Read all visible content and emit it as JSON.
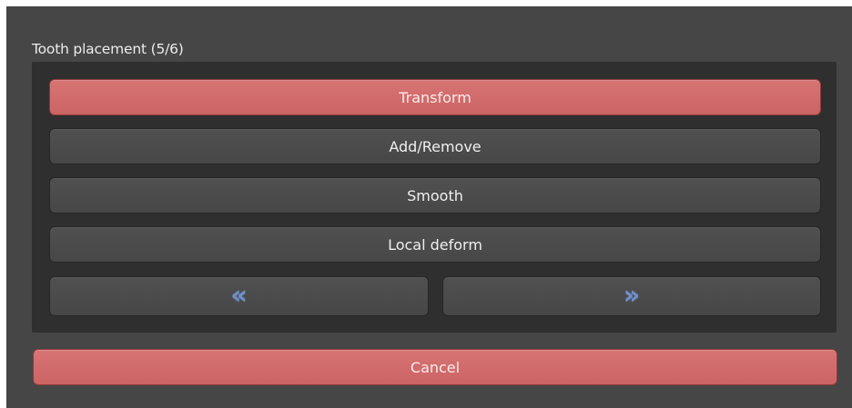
{
  "panel": {
    "title": "Tooth placement (5/6)"
  },
  "tools": {
    "transform_label": "Transform",
    "add_remove_label": "Add/Remove",
    "smooth_label": "Smooth",
    "local_deform_label": "Local deform",
    "active_tool": "Transform"
  },
  "navigation": {
    "previous_glyph": "«",
    "next_glyph": "»",
    "previous_icon": "double-chevron-left-icon",
    "next_icon": "double-chevron-right-icon"
  },
  "footer": {
    "cancel_label": "Cancel"
  },
  "colors": {
    "panel_background": "#464646",
    "group_background": "#2f2f2f",
    "button_background": "#4b4b4b",
    "active_button": "#d06868",
    "arrow_accent": "#6f8ed0",
    "text": "#efefef"
  }
}
